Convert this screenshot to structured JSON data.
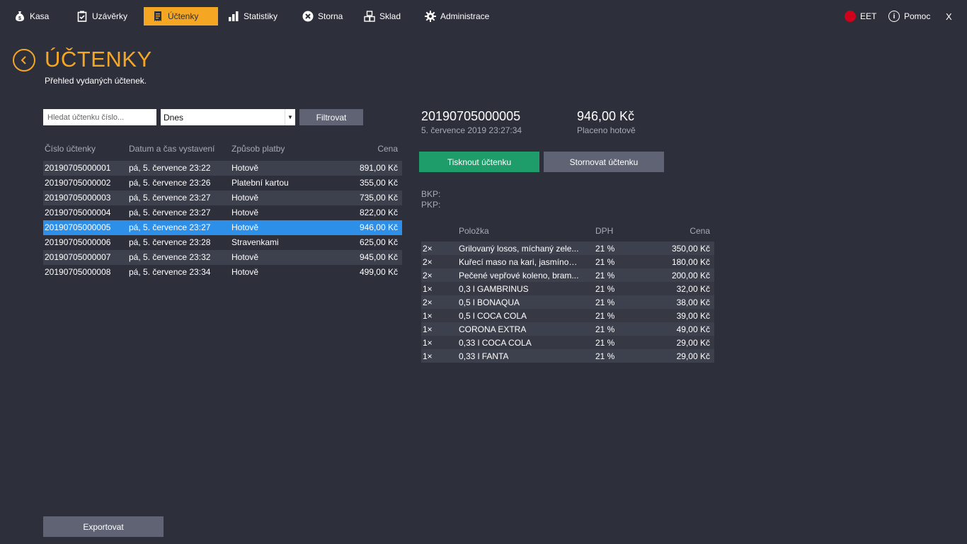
{
  "nav": {
    "items": [
      {
        "label": "Kasa",
        "icon": "money-bag-icon"
      },
      {
        "label": "Uzávěrky",
        "icon": "clipboard-check-icon"
      },
      {
        "label": "Účtenky",
        "icon": "receipt-icon"
      },
      {
        "label": "Statistiky",
        "icon": "bar-chart-icon"
      },
      {
        "label": "Storna",
        "icon": "cancel-circle-icon"
      },
      {
        "label": "Sklad",
        "icon": "boxes-icon"
      },
      {
        "label": "Administrace",
        "icon": "gear-icon"
      }
    ],
    "active_index": 2,
    "eet_label": "EET",
    "help_label": "Pomoc",
    "close_label": "X",
    "accent_color": "#f5a623",
    "eet_status_color": "#d0021b"
  },
  "header": {
    "title": "ÚČTENKY",
    "subtitle": "Přehled vydaných účtenek."
  },
  "filters": {
    "search_placeholder": "Hledat účtenku číslo...",
    "date_value": "Dnes",
    "filter_label": "Filtrovat"
  },
  "receipts": {
    "columns": [
      "Číslo účtenky",
      "Datum a čas vystavení",
      "Způsob platby",
      "Cena"
    ],
    "rows": [
      {
        "number": "20190705000001",
        "date": "pá, 5. července 23:22",
        "payment": "Hotově",
        "price": "891,00 Kč"
      },
      {
        "number": "20190705000002",
        "date": "pá, 5. července 23:26",
        "payment": "Platební kartou",
        "price": "355,00 Kč"
      },
      {
        "number": "20190705000003",
        "date": "pá, 5. července 23:27",
        "payment": "Hotově",
        "price": "735,00 Kč"
      },
      {
        "number": "20190705000004",
        "date": "pá, 5. července 23:27",
        "payment": "Hotově",
        "price": "822,00 Kč"
      },
      {
        "number": "20190705000005",
        "date": "pá, 5. července 23:27",
        "payment": "Hotově",
        "price": "946,00 Kč"
      },
      {
        "number": "20190705000006",
        "date": "pá, 5. července 23:28",
        "payment": "Stravenkami",
        "price": "625,00 Kč"
      },
      {
        "number": "20190705000007",
        "date": "pá, 5. července 23:32",
        "payment": "Hotově",
        "price": "945,00 Kč"
      },
      {
        "number": "20190705000008",
        "date": "pá, 5. července 23:34",
        "payment": "Hotově",
        "price": "499,00 Kč"
      }
    ],
    "selected_index": 4,
    "export_label": "Exportovat"
  },
  "detail": {
    "number": "20190705000005",
    "date": "5. července 2019 23:27:34",
    "total": "946,00 Kč",
    "paid_label": "Placeno hotově",
    "print_label": "Tisknout účtenku",
    "storno_label": "Stornovat účtenku",
    "bkp_label": "BKP:",
    "pkp_label": "PKP:",
    "item_columns": [
      "Položka",
      "DPH",
      "Cena"
    ],
    "items": [
      {
        "qty": "2×",
        "name": "Grilovaný losos, míchaný zele...",
        "vat": "21 %",
        "price": "350,00 Kč"
      },
      {
        "qty": "2×",
        "name": "Kuřecí maso na kari, jasmínov...",
        "vat": "21 %",
        "price": "180,00 Kč"
      },
      {
        "qty": "2×",
        "name": "Pečené vepřové koleno, bram...",
        "vat": "21 %",
        "price": "200,00 Kč"
      },
      {
        "qty": "1×",
        "name": "0,3 l GAMBRINUS",
        "vat": "21 %",
        "price": "32,00 Kč"
      },
      {
        "qty": "2×",
        "name": "0,5 l BONAQUA",
        "vat": "21 %",
        "price": "38,00 Kč"
      },
      {
        "qty": "1×",
        "name": "0,5 l COCA COLA",
        "vat": "21 %",
        "price": "39,00 Kč"
      },
      {
        "qty": "1×",
        "name": "CORONA EXTRA",
        "vat": "21 %",
        "price": "49,00 Kč"
      },
      {
        "qty": "1×",
        "name": "0,33 l COCA COLA",
        "vat": "21 %",
        "price": "29,00 Kč"
      },
      {
        "qty": "1×",
        "name": "0,33 l FANTA",
        "vat": "21 %",
        "price": "29,00 Kč"
      }
    ]
  }
}
